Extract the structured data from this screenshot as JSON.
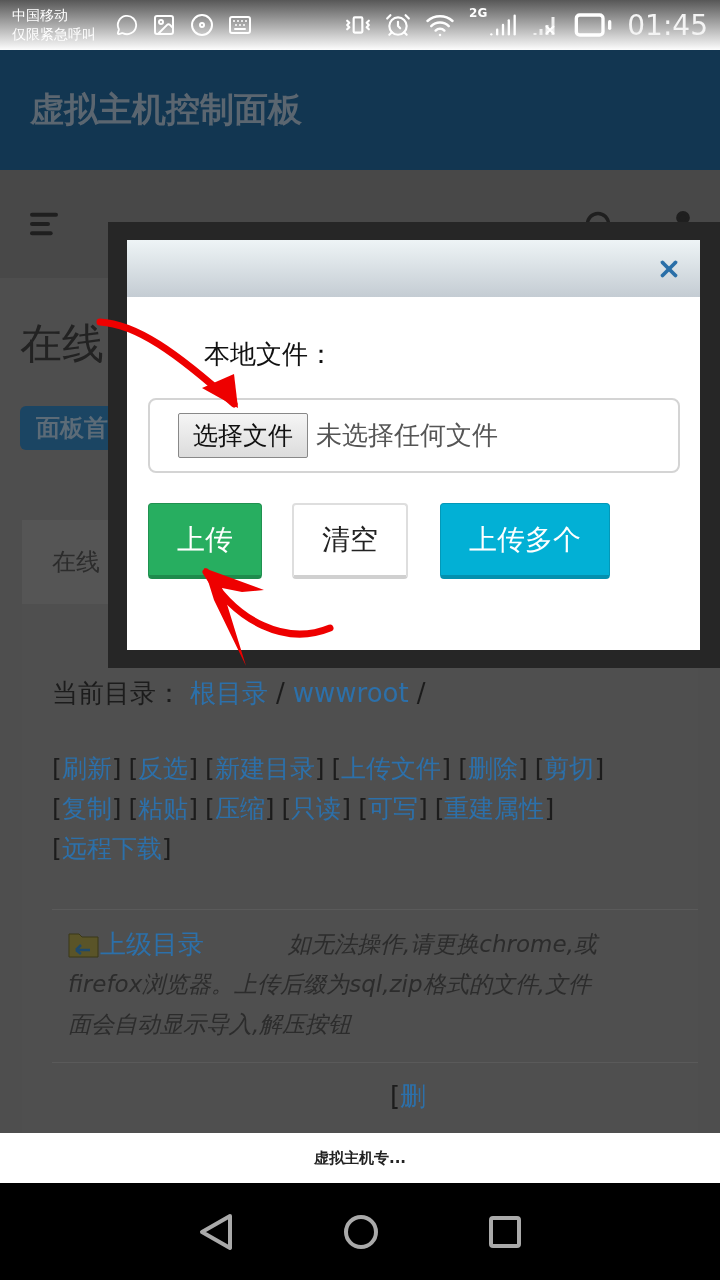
{
  "status_bar": {
    "carrier": "中国移动",
    "network_note": "仅限紧急呼叫",
    "network_type": "2G",
    "time": "01:45"
  },
  "header": {
    "title": "虚拟主机控制面板"
  },
  "page": {
    "title": "在线",
    "badge": "面板首",
    "card_tab": "在线",
    "current_dir_label": "当前目录：",
    "path": [
      {
        "label": "根目录"
      },
      {
        "label": "wwwroot"
      }
    ],
    "path_separator": "/",
    "bracket_open": "[",
    "bracket_close": "]",
    "actions": [
      "刷新",
      "反选",
      "新建目录",
      "上传文件",
      "删除",
      "剪切",
      "复制",
      "粘贴",
      "压缩",
      "只读",
      "可写",
      "重建属性",
      "远程下载"
    ],
    "parent_dir_link": "上级目录",
    "note_lines": [
      "如无法操作,请更换chrome,或",
      "firefox浏览器。上传后缀为sql,zip格式的文件,文件",
      "面会自动显示导入,解压按钮"
    ],
    "next_row_fragment": "删"
  },
  "modal": {
    "label": "本地文件：",
    "file_button": "选择文件",
    "file_status": "未选择任何文件",
    "buttons": [
      {
        "label": "上传",
        "kind": "success"
      },
      {
        "label": "清空",
        "kind": "default"
      },
      {
        "label": "上传多个",
        "kind": "info"
      }
    ]
  },
  "bottom_bar": {
    "title": "虚拟主机专..."
  }
}
